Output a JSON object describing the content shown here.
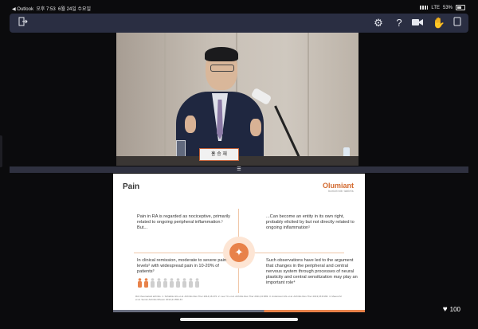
{
  "status_bar": {
    "back_app": "◀ Outlook",
    "time": "오후 7:53",
    "date": "6월 24일 수요일",
    "network": "LTE",
    "battery": "53%"
  },
  "toolbar": {
    "leave_icon": "exit-icon",
    "settings_icon": "gear-icon",
    "help_icon": "help-icon",
    "camera_icon": "video-camera-icon",
    "raise_hand_icon": "hand-icon",
    "menu_icon": "more-icon"
  },
  "video": {
    "nameplate": "홍 승 재"
  },
  "slide": {
    "title": "Pain",
    "logo_brand": "Olumiant",
    "logo_sub": "baricitinib tablets",
    "q1": "Pain in RA is regarded as nociceptive, primarily related to ongoing peripheral inflammation.¹ But...",
    "q2": "...Can become an entity in its own right, probably elicited by but not directly related to ongoing inflammation¹",
    "q3": "In clinical remission, moderate to severe pain levels² with widespread pain in 10-20% of patients³",
    "q4": "Such observations have led to the argument that changes in the peripheral and central nervous system through processes of neural plasticity and central sensitization may play an important role⁴",
    "refs": "RA=rheumatoid arthritis. 1. Schaible HG et al. Arthritis Res Ther 2014;16:470. 2. Lee YC et al. Arthritis Res Ther 2011;13:R83. 3. Andersson ML et al. Arthritis Res Ther 2013;15:R166. 4. Meeus M et al. Semin Arthritis Rheum 2012;41:556-67."
  },
  "likes": {
    "count": "100"
  }
}
